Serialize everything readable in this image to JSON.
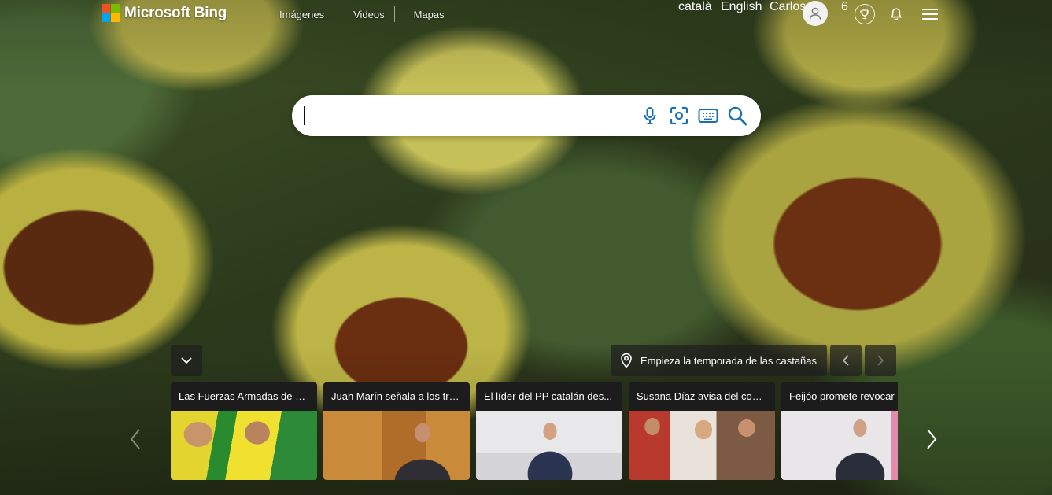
{
  "brand": {
    "name": "Microsoft Bing",
    "logo_colors": [
      "#f25022",
      "#7fba00",
      "#00a4ef",
      "#ffb900"
    ]
  },
  "nav": {
    "items": [
      "Imágenes",
      "Videos",
      "Mapas"
    ]
  },
  "header_right": {
    "lang_ca": "català",
    "lang_en": "English",
    "user_name": "Carlos",
    "rewards_points": "6"
  },
  "search": {
    "value": "",
    "icons": [
      "microphone-icon",
      "visual-search-icon",
      "keyboard-icon",
      "search-icon"
    ]
  },
  "image_info": {
    "label": "Empieza la temporada de las castañas"
  },
  "news": [
    {
      "title": "Las Fuerzas Armadas de Br..."
    },
    {
      "title": "Juan Marín señala a los tre..."
    },
    {
      "title": "El líder del PP catalán des..."
    },
    {
      "title": "Susana Díaz avisa del coste..."
    },
    {
      "title": "Feijóo promete revocar l"
    }
  ],
  "colors": {
    "accent": "#1a6fb0",
    "card_header": "#1c1c1c"
  }
}
